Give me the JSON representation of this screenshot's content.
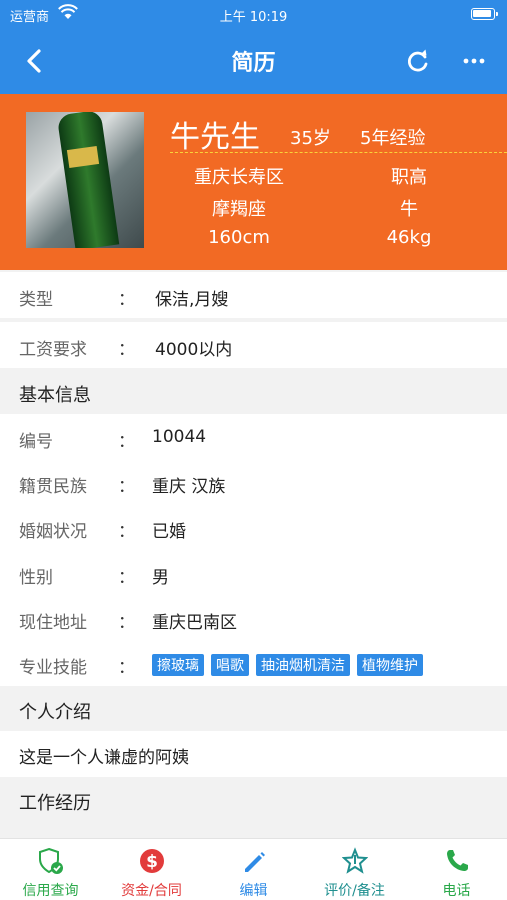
{
  "status_bar": {
    "carrier": "运营商",
    "time": "上午 10:19"
  },
  "nav": {
    "title": "简历"
  },
  "profile": {
    "name": "牛先生",
    "age": "35岁",
    "experience": "5年经验",
    "location": "重庆长寿区",
    "education": "职高",
    "constellation": "摩羯座",
    "zodiac": "牛",
    "height": "160cm",
    "weight": "46kg"
  },
  "summary": {
    "type_label": "类型",
    "type_value": "保洁,月嫂",
    "salary_label": "工资要求",
    "salary_value": "4000以内"
  },
  "colon": "：",
  "basic_info": {
    "heading": "基本信息",
    "fields": [
      {
        "label": "编号",
        "value": "10044"
      },
      {
        "label": "籍贯民族",
        "value": "重庆 汉族"
      },
      {
        "label": "婚姻状况",
        "value": "已婚"
      },
      {
        "label": "性别",
        "value": "男"
      },
      {
        "label": "现住地址",
        "value": "重庆巴南区"
      }
    ],
    "skills_label": "专业技能",
    "skills": [
      "擦玻璃",
      "唱歌",
      "抽油烟机清洁",
      "植物维护"
    ]
  },
  "intro": {
    "heading": "个人介绍",
    "text": "这是一个人谦虚的阿姨"
  },
  "work": {
    "heading": "工作经历"
  },
  "tabs": [
    {
      "label": "信用查询",
      "color": "#2aa84a",
      "icon": "shield-check-icon"
    },
    {
      "label": "资金/合同",
      "color": "#e23b3b",
      "icon": "dollar-circle-icon"
    },
    {
      "label": "编辑",
      "color": "#2f8be6",
      "icon": "pencil-icon"
    },
    {
      "label": "评价/备注",
      "color": "#1f8f8f",
      "icon": "star-icon"
    },
    {
      "label": "电话",
      "color": "#2aa84a",
      "icon": "phone-icon"
    }
  ],
  "colors": {
    "primary": "#2f8be6",
    "profile_bg": "#f26a24"
  }
}
